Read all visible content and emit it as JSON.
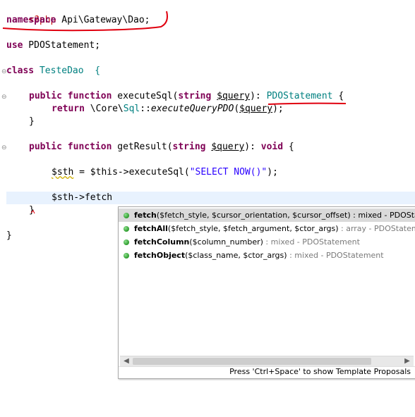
{
  "code": {
    "php_open": "<?php",
    "namespace_kw": "namespace",
    "namespace_name": " Api\\Gateway\\Dao;",
    "use_kw": "use",
    "use_name": " PDOStatement;",
    "class_kw": "class",
    "class_name": " TesteDao  {",
    "m1_public": "public",
    "m1_function": "function",
    "m1_name": " executeSql(",
    "m1_type": "string",
    "m1_param": "$query",
    "m1_after_param": "): ",
    "m1_return_type": "PDOStatement",
    "m1_brace": " {",
    "m1_return_kw": "return",
    "m1_call_prefix": " \\Core\\",
    "m1_call_class": "Sql",
    "m1_call_sep": "::",
    "m1_call_method": "executeQueryPDO",
    "m1_call_open": "(",
    "m1_call_arg": "$query",
    "m1_call_close": ");",
    "m1_close": "}",
    "m2_public": "public",
    "m2_function": "function",
    "m2_name": " getResult(",
    "m2_type": "string",
    "m2_param": "$query",
    "m2_after_param": "): ",
    "m2_return_kw": "void",
    "m2_brace": " {",
    "m2_sth": "$sth",
    "m2_assign": " = $this->executeSql(",
    "m2_sql": "\"SELECT NOW()\"",
    "m2_assign_close": ");",
    "m2_typing": "$sth->fetch",
    "m2_close": "}",
    "class_close": "}"
  },
  "autocomplete": {
    "proposals": [
      {
        "name": "fetch",
        "signature": "($fetch_style, $cursor_orientation, $cursor_offset)",
        "sep": " : ",
        "type": "mixed",
        "owner": " - PDOStatement",
        "selected": true
      },
      {
        "name": "fetchAll",
        "signature": "($fetch_style, $fetch_argument, $ctor_args)",
        "sep": " : ",
        "type": "array",
        "owner": " - PDOStatement",
        "selected": false
      },
      {
        "name": "fetchColumn",
        "signature": "($column_number)",
        "sep": " : ",
        "type": "mixed",
        "owner": " - PDOStatement",
        "selected": false
      },
      {
        "name": "fetchObject",
        "signature": "($class_name, $ctor_args)",
        "sep": " : ",
        "type": "mixed",
        "owner": " - PDOStatement",
        "selected": false
      }
    ],
    "status": "Press 'Ctrl+Space' to show Template Proposals"
  },
  "colors": {
    "keyword": "#7f0055",
    "php_tag": "#c00000",
    "string": "#2a00ff",
    "annotation": "#e0000f",
    "current_line": "#e8f2fe"
  }
}
